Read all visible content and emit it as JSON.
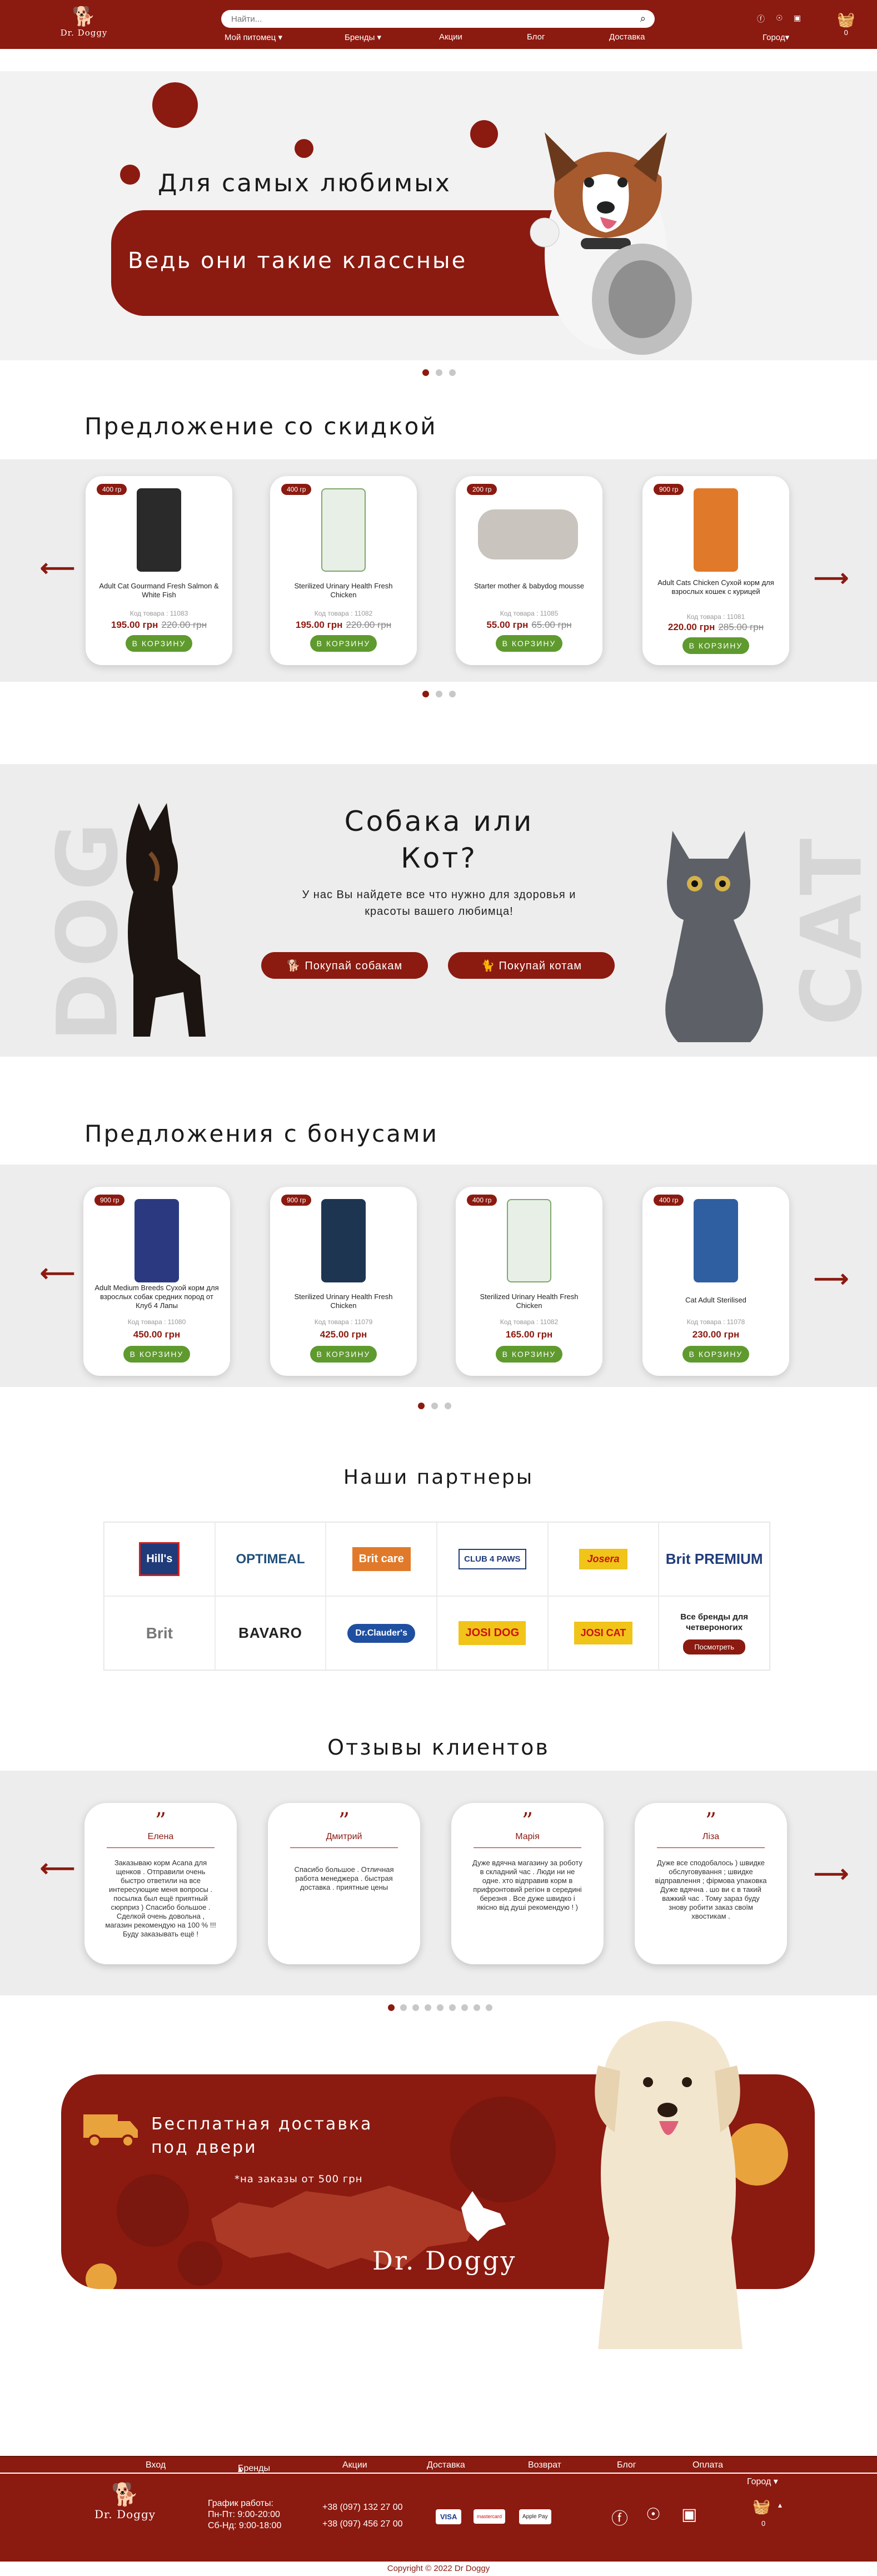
{
  "header": {
    "logo": "Dr. Doggy",
    "search_placeholder": "Найти...",
    "nav": [
      "Мой питомец",
      "Бренды",
      "Акции",
      "Блог",
      "Доставка"
    ],
    "city": "Город",
    "cart_count": "0"
  },
  "hero": {
    "line1": "Для самых любимых",
    "line2": "Ведь они такие классные"
  },
  "discount": {
    "title": "Предложение со скидкой",
    "add_label": "В КОРЗИНУ",
    "items": [
      {
        "weight": "400 гр",
        "name": "Adult Cat Gourmand Fresh Salmon & White Fish",
        "code": "Код товара : 11083",
        "price": "195.00 грн",
        "old": "220.00 грн"
      },
      {
        "weight": "400 гр",
        "name": "Sterilized Urinary Health Fresh Chicken",
        "code": "Код товара : 11082",
        "price": "195.00 грн",
        "old": "220.00 грн"
      },
      {
        "weight": "200 гр",
        "name": "Starter mother & babydog mousse",
        "code": "Код товара : 11085",
        "price": "55.00 грн",
        "old": "65.00 грн"
      },
      {
        "weight": "900 гр",
        "name": "Adult Cats Chicken Сухой корм для взрослых кошек с курицей",
        "code": "Код товара : 11081",
        "price": "220.00 грн",
        "old": "285.00 грн"
      }
    ]
  },
  "dogcat": {
    "dog_word": "DOG",
    "cat_word": "CAT",
    "title": "Собака или Кот?",
    "subtitle": "У нас Вы найдете все что нужно для здоровья и красоты вашего любимца!",
    "dog_button": "Покупай собакам",
    "cat_button": "Покупай котам"
  },
  "bonus": {
    "title": "Предложения с бонусами",
    "add_label": "В КОРЗИНУ",
    "items": [
      {
        "weight": "900 гр",
        "name": "Adult Medium Breeds Сухой корм для взрослых собак средних пород от Клуб 4 Лапы",
        "code": "Код товара : 11080",
        "price": "450.00 грн"
      },
      {
        "weight": "900 гр",
        "name": "Sterilized Urinary Health Fresh Chicken",
        "code": "Код товара : 11079",
        "price": "425.00 грн"
      },
      {
        "weight": "400 гр",
        "name": "Sterilized Urinary Health Fresh Chicken",
        "code": "Код товара : 11082",
        "price": "165.00 грн"
      },
      {
        "weight": "400 гр",
        "name": "Cat Adult Sterilised",
        "code": "Код товара : 11078",
        "price": "230.00 грн"
      }
    ]
  },
  "partners": {
    "title": "Наши партнеры",
    "row1": [
      "Hill's",
      "OPTIMEAL",
      "Brit care",
      "CLUB 4 PAWS",
      "Josera",
      "Brit PREMIUM"
    ],
    "row2": [
      "Brit",
      "BAVARO",
      "Dr.Clauder's",
      "JOSI DOG",
      "JOSI CAT"
    ],
    "all_text": "Все бренды для четвероногих",
    "all_button": "Посмотреть"
  },
  "reviews": {
    "title": "Отзывы клиентов",
    "items": [
      {
        "name": "Елена",
        "text": "Заказываю корм Acana для щенков . Отправили очень быстро ответили на все интересующие меня вопросы . посылка был ещё приятный сюрприз ) Спасибо большое . Сделкой очень довольна , магазин рекомендую на 100 % !!! Буду заказывать ещё !"
      },
      {
        "name": "Дмитрий",
        "text": "Спасибо большое . Отличная работа менеджера . быстрая доставка . приятные цены"
      },
      {
        "name": "Марія",
        "text": "Дуже вдячна магазину за роботу в складний час . Люди ни не одне. хто відправив корм в прифронтовий регіон в середині березня . Все дуже швидко і якісно від душі рекомендую ! )"
      },
      {
        "name": "Ліза",
        "text": "Дуже все сподобалось ) швидке обслуговування ; швидке відправлення ; фірмова упаковка Дуже вдячна . шо ви є в такий важкий час . Тому зараз буду знову робити заказ своїм хвостикам ."
      }
    ]
  },
  "delivery": {
    "line1": "Бесплатная доставка",
    "line2": "под двери",
    "note": "*на заказы от 500 грн",
    "brand": "Dr. Doggy"
  },
  "footer": {
    "nav": [
      "Вход",
      "Бренды",
      "Акции",
      "Доставка",
      "Возврат",
      "Блог",
      "Оплата"
    ],
    "logo": "Dr. Doggy",
    "hours_title": "График работы:",
    "hours1": "Пн-Пт: 9:00-20:00",
    "hours2": "Сб-Нд: 9:00-18:00",
    "phone1": "+38 (097) 132 27 00",
    "phone2": "+38 (097) 456 27 00",
    "payments": [
      "VISA",
      "mastercard",
      "Apple Pay"
    ],
    "city": "Город",
    "copyright": "Copyright © 2022 Dr Doggy"
  },
  "colors": {
    "brand": "#8b1a10",
    "button_green": "#5f9a2e",
    "band": "#ededed"
  }
}
